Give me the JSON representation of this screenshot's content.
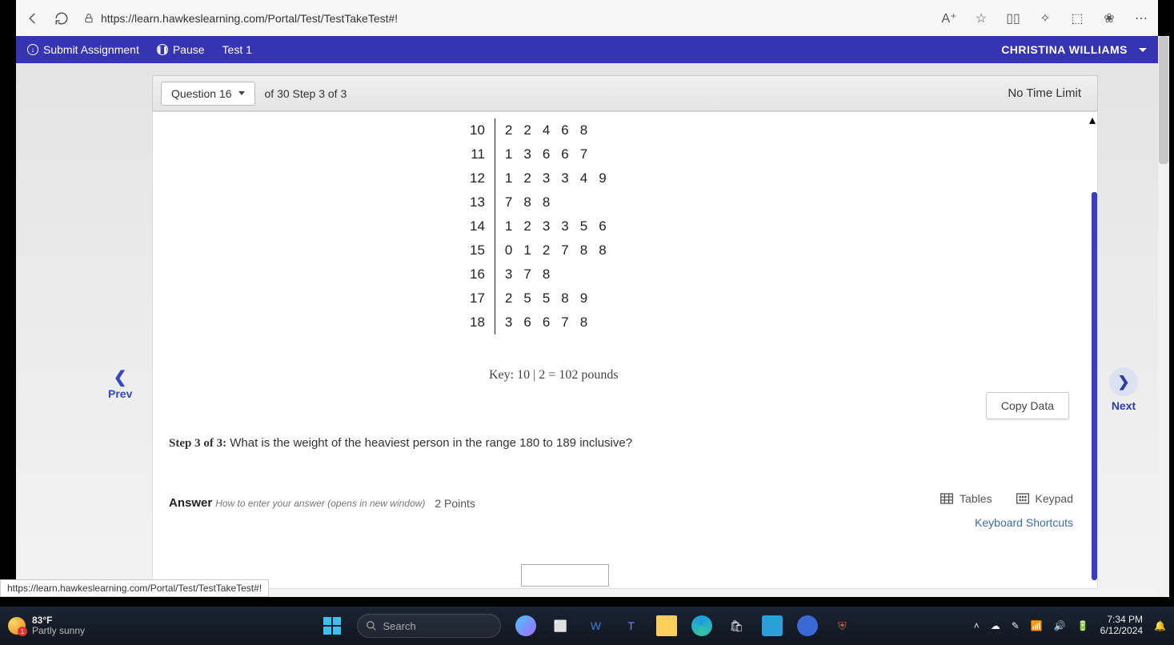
{
  "browser": {
    "url": "https://learn.hawkeslearning.com/Portal/Test/TestTakeTest#!",
    "status_url": "https://learn.hawkeslearning.com/Portal/Test/TestTakeTest#!"
  },
  "app": {
    "submit": "Submit Assignment",
    "pause": "Pause",
    "test_label": "Test 1",
    "user": "CHRISTINA WILLIAMS"
  },
  "question_bar": {
    "button": "Question 16",
    "step": "of 30 Step 3 of 3",
    "timer": "No Time Limit"
  },
  "chart_data": {
    "type": "table",
    "description": "Stem-and-leaf plot of weights in pounds",
    "stems": [
      10,
      11,
      12,
      13,
      14,
      15,
      16,
      17,
      18
    ],
    "leaves": [
      [
        2,
        2,
        4,
        6,
        8
      ],
      [
        1,
        3,
        6,
        6,
        7
      ],
      [
        1,
        2,
        3,
        3,
        4,
        9
      ],
      [
        7,
        8,
        8
      ],
      [
        1,
        2,
        3,
        3,
        5,
        6
      ],
      [
        0,
        1,
        2,
        7,
        8,
        8
      ],
      [
        3,
        7,
        8
      ],
      [
        2,
        5,
        5,
        8,
        9
      ],
      [
        3,
        6,
        6,
        7,
        8
      ]
    ],
    "key": "Key: 10 | 2  =  102 pounds"
  },
  "buttons": {
    "copy": "Copy Data",
    "prev": "Prev",
    "next": "Next",
    "tables": "Tables",
    "keypad": "Keypad",
    "kbd": "Keyboard Shortcuts"
  },
  "prompt": {
    "label": "Step 3 of 3:",
    "text": " What is the weight of the heaviest person in the range 180 to 189 inclusive?"
  },
  "answer": {
    "label": "Answer",
    "hint": "How to enter your answer (opens in new window)",
    "points": "2 Points",
    "value": ""
  },
  "taskbar": {
    "temp": "83°F",
    "cond": "Partly sunny",
    "weather_badge": "1",
    "search_placeholder": "Search",
    "time": "7:34 PM",
    "date": "6/12/2024"
  }
}
